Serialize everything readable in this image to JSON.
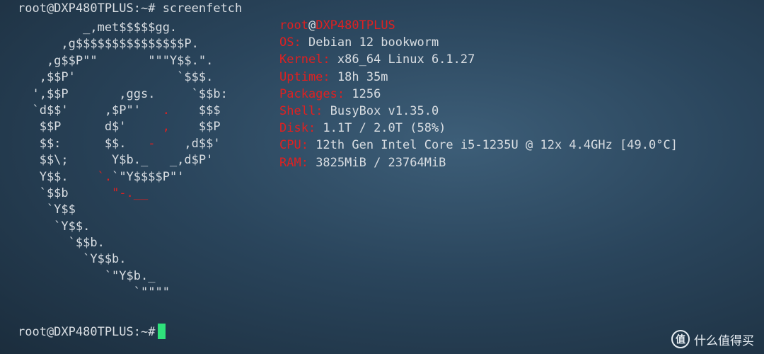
{
  "terminal": {
    "command_prompt": "root@DXP480TPLUS:~# screenfetch",
    "final_prompt": "root@DXP480TPLUS:~#",
    "logo_lines": [
      [
        {
          "t": "         _,met$$$$$gg.",
          "c": "g"
        }
      ],
      [
        {
          "t": "      ,g$$$$$$$$$$$$$$$P.",
          "c": "g"
        }
      ],
      [
        {
          "t": "    ,g$$P\"\"       \"\"\"Y$$.\".",
          "c": "g"
        }
      ],
      [
        {
          "t": "   ,$$P'              `$$$.",
          "c": "g"
        }
      ],
      [
        {
          "t": "  ',$$P       ,ggs.     `$$b:",
          "c": "g"
        }
      ],
      [
        {
          "t": "  `d$$'     ,$P\"'   ",
          "c": "g"
        },
        {
          "t": ".",
          "c": "r"
        },
        {
          "t": "    $$$",
          "c": "g"
        }
      ],
      [
        {
          "t": "   $$P      d$'     ",
          "c": "g"
        },
        {
          "t": ",",
          "c": "r"
        },
        {
          "t": "    $$P",
          "c": "g"
        }
      ],
      [
        {
          "t": "   $$:      $$.   ",
          "c": "g"
        },
        {
          "t": "-",
          "c": "r"
        },
        {
          "t": "    ,d$$'",
          "c": "g"
        }
      ],
      [
        {
          "t": "   $$\\;      Y$b._   _,d$P'",
          "c": "g"
        }
      ],
      [
        {
          "t": "   Y$$.    ",
          "c": "g"
        },
        {
          "t": "`.",
          "c": "r"
        },
        {
          "t": "`\"Y$$$$P\"'",
          "c": "g"
        }
      ],
      [
        {
          "t": "   `$$b      ",
          "c": "g"
        },
        {
          "t": "\"-.__",
          "c": "r"
        }
      ],
      [
        {
          "t": "    `Y$$",
          "c": "g"
        }
      ],
      [
        {
          "t": "     `Y$$.",
          "c": "g"
        }
      ],
      [
        {
          "t": "       `$$b.",
          "c": "g"
        }
      ],
      [
        {
          "t": "         `Y$$b.",
          "c": "g"
        }
      ],
      [
        {
          "t": "            `\"Y$b._",
          "c": "g"
        }
      ],
      [
        {
          "t": "                `\"\"\"\"",
          "c": "g"
        }
      ]
    ],
    "user_host": {
      "user": "root",
      "at": "@",
      "host": "DXP480TPLUS"
    },
    "info": [
      {
        "key": "OS:",
        "value": " Debian 12 bookworm"
      },
      {
        "key": "Kernel:",
        "value": " x86_64 Linux 6.1.27"
      },
      {
        "key": "Uptime:",
        "value": " 18h 35m"
      },
      {
        "key": "Packages:",
        "value": " 1256"
      },
      {
        "key": "Shell:",
        "value": " BusyBox v1.35.0"
      },
      {
        "key": "Disk:",
        "value": " 1.1T / 2.0T (58%)"
      },
      {
        "key": "CPU:",
        "value": " 12th Gen Intel Core i5-1235U @ 12x 4.4GHz [49.0°C]"
      },
      {
        "key": "RAM:",
        "value": " 3825MiB / 23764MiB"
      }
    ]
  },
  "watermark": {
    "icon_text": "值",
    "text": "什么值得买"
  },
  "colors": {
    "accent_red": "#e02020",
    "cursor_green": "#2fe27b",
    "text": "#d8dde2"
  }
}
